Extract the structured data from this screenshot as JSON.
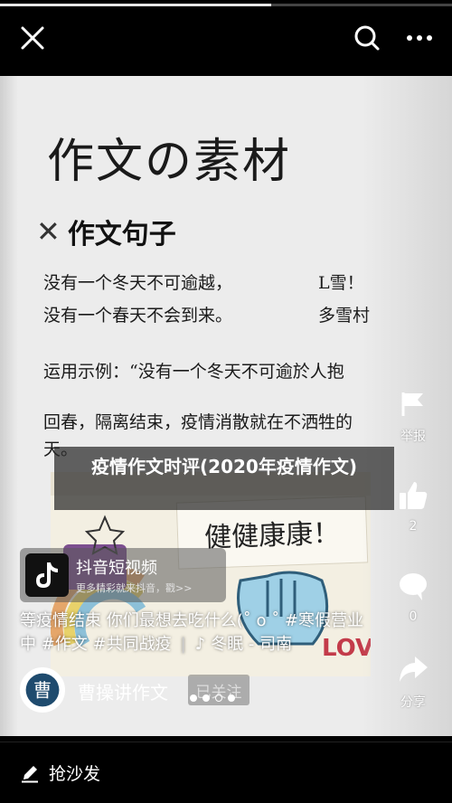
{
  "progress": {
    "played_fraction": 0.6
  },
  "top_bar": {
    "close_icon": "close-icon",
    "search_icon": "search-icon",
    "more_icon": "more-icon"
  },
  "video": {
    "doc_title": "作文の素材",
    "section_heading": "作文句子",
    "lines": [
      "没有一个冬天不可逾越，",
      "没有一个春天不会到来。",
      "运用示例：“没有一个冬天不可逾於人抱",
      "回春，隔离结束，疫情消散就在不洒牲的",
      "天。"
    ],
    "lines_right": [
      "L雪！",
      "多雪村"
    ],
    "photo_sign": "健健康康！",
    "photo_love": "LOVE",
    "caption": "疫情作文时评(2020年疫情作文)"
  },
  "sidebar": {
    "like_count": "2",
    "comment_count": "0",
    "share_label": "分享",
    "report_label": "举报"
  },
  "promo": {
    "title": "抖音短视频",
    "subtitle": "更多精彩就来抖音，戳>>"
  },
  "description": {
    "line1": "等疫情结束 你们最想去吃什么(˚ o ˚ #寒假营业",
    "line2_tags": "中 #作文 #共同战疫",
    "music_title": "冬眠 - 司南"
  },
  "author": {
    "name": "曹操讲作文",
    "avatar_char": "曹",
    "follow_label": "已关注"
  },
  "bottom_bar": {
    "comment_placeholder": "抢沙发"
  }
}
